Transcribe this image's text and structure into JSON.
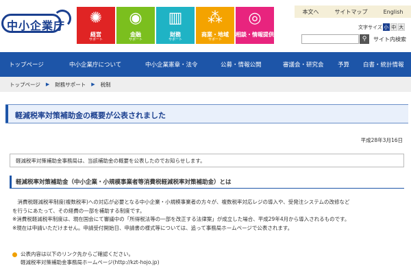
{
  "header": {
    "logo_text": "中小企業庁",
    "categories": [
      {
        "label": "経営",
        "sub": "サポート",
        "icon": "spiral-icon",
        "glyph": "✺",
        "color": "#e02424"
      },
      {
        "label": "金融",
        "sub": "サポート",
        "icon": "coins-icon",
        "glyph": "◉",
        "color": "#7bbf1e"
      },
      {
        "label": "財務",
        "sub": "サポート",
        "icon": "chart-icon",
        "glyph": "▥",
        "color": "#1fb3c5"
      },
      {
        "label": "商業・地域",
        "sub": "サポート",
        "icon": "network-icon",
        "glyph": "⁂",
        "color": "#f4a300"
      },
      {
        "label": "相談・情報提供",
        "sub": "",
        "icon": "signal-icon",
        "glyph": "◎",
        "color": "#e8247e"
      }
    ],
    "top_links": [
      "本文へ",
      "サイトマップ",
      "English"
    ],
    "font_size": {
      "label": "文字サイズ",
      "options": [
        "小",
        "中",
        "大"
      ],
      "selected": "小"
    },
    "search": {
      "value": "",
      "placeholder": "",
      "label": "サイト内検索"
    }
  },
  "nav": {
    "items": [
      "トップページ",
      "中小企業庁について",
      "中小企業憲章・法令",
      "公募・情報公開",
      "審議会・研究会",
      "予算",
      "白書・統計情報"
    ]
  },
  "breadcrumb": [
    "トップページ",
    "財務サポート",
    "税制"
  ],
  "page": {
    "title": "軽減税率対策補助金の概要が公表されました",
    "date": "平成28年3月16日",
    "notice": "軽減税率対策補助金事務局は、当該補助金の概要を公表したのでお知らせします。",
    "section_heading": "軽減税率対策補助金（中小企業・小規模事業者等消費税軽減税率対策補助金）とは",
    "body": [
      "　消費税軽減税率制度(複数税率)への対応が必要となる中小企業・小規模事業者の方々が、複数税率対応レジの導入や、受発注システムの改修など",
      "を行うにあたって、その経費の一部を補助する制度です。",
      "※消費税軽減税率制度は、現在国会にて審議中の「所得税法等の一部を改正する法律案」が成立した場合、平成29年4月から導入されるものです。",
      "※現在は申請いただけません。申請受付開始日、申請書の様式等については、追って事務局ホームページで公表されます。"
    ],
    "link_intro": "公表内容は以下のリンク先からご確認ください。",
    "link_text": "軽減税率対策補助金事務局ホームページ(http://kzt-hojo.jp)"
  }
}
